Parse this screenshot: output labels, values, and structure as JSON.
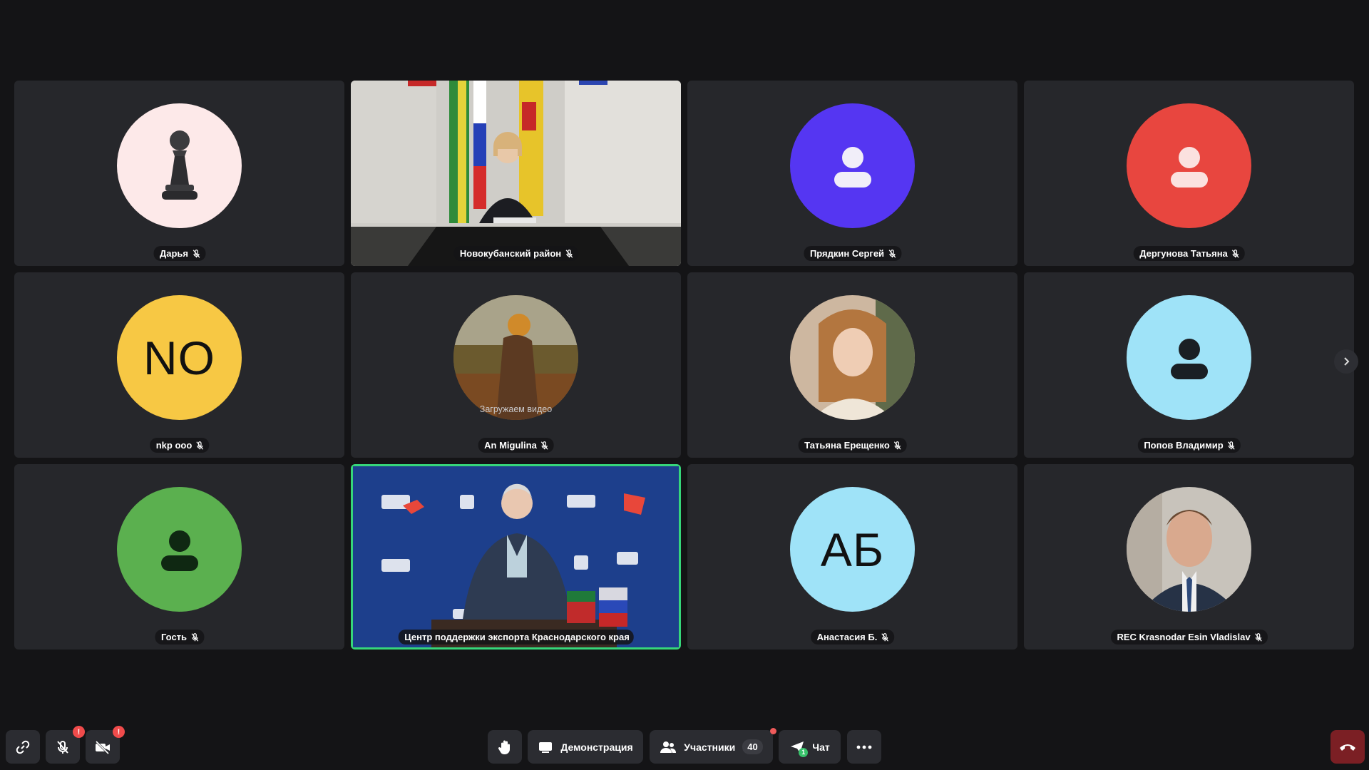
{
  "participants": [
    {
      "name": "Дарья",
      "type": "pawn",
      "bg": "#fde9e9"
    },
    {
      "name": "Новокубанский район",
      "type": "video"
    },
    {
      "name": "Прядкин Сергей",
      "type": "person",
      "bg": "#5536f2",
      "fg": "#f1eef9"
    },
    {
      "name": "Дергунова Татьяна",
      "type": "person",
      "bg": "#e8463f",
      "fg": "#fbe1df"
    },
    {
      "name": "nkp ooo",
      "type": "initials",
      "initials": "NO",
      "bg": "#f7c844"
    },
    {
      "name": "An Migulina",
      "type": "photo",
      "bg": "#6b4a2a",
      "status": "Загружаем видео"
    },
    {
      "name": "Татьяна Ерещенко",
      "type": "photo",
      "bg": "#c9a98a"
    },
    {
      "name": "Попов Владимир",
      "type": "person",
      "bg": "#9fe3f8",
      "fg": "#1a1f24"
    },
    {
      "name": "Гость",
      "type": "person",
      "bg": "#5bb04f",
      "fg": "#0f2812"
    },
    {
      "name": "Центр поддержки экспорта Краснодарского края",
      "type": "video",
      "active": true
    },
    {
      "name": "Анастасия Б.",
      "type": "initials",
      "initials": "АБ",
      "bg": "#9fe3f8"
    },
    {
      "name": "REC Krasnodar Esin Vladislav",
      "type": "photo",
      "bg": "#9a8a7a"
    }
  ],
  "toolbar": {
    "demo_label": "Демонстрация",
    "participants_label": "Участники",
    "participants_count": "40",
    "chat_label": "Чат",
    "chat_unread": "1",
    "mic_alert": "!",
    "camera_alert": "!"
  },
  "icons": [
    "link-icon",
    "mic-off-icon",
    "camera-off-icon",
    "raise-hand-icon",
    "screen-share-icon",
    "participants-icon",
    "chat-icon",
    "more-icon",
    "hangup-icon",
    "chevron-right-icon"
  ],
  "colors": {
    "active_border": "#36d67a",
    "alert": "#f04b4b",
    "hangup": "#7b1f24"
  }
}
